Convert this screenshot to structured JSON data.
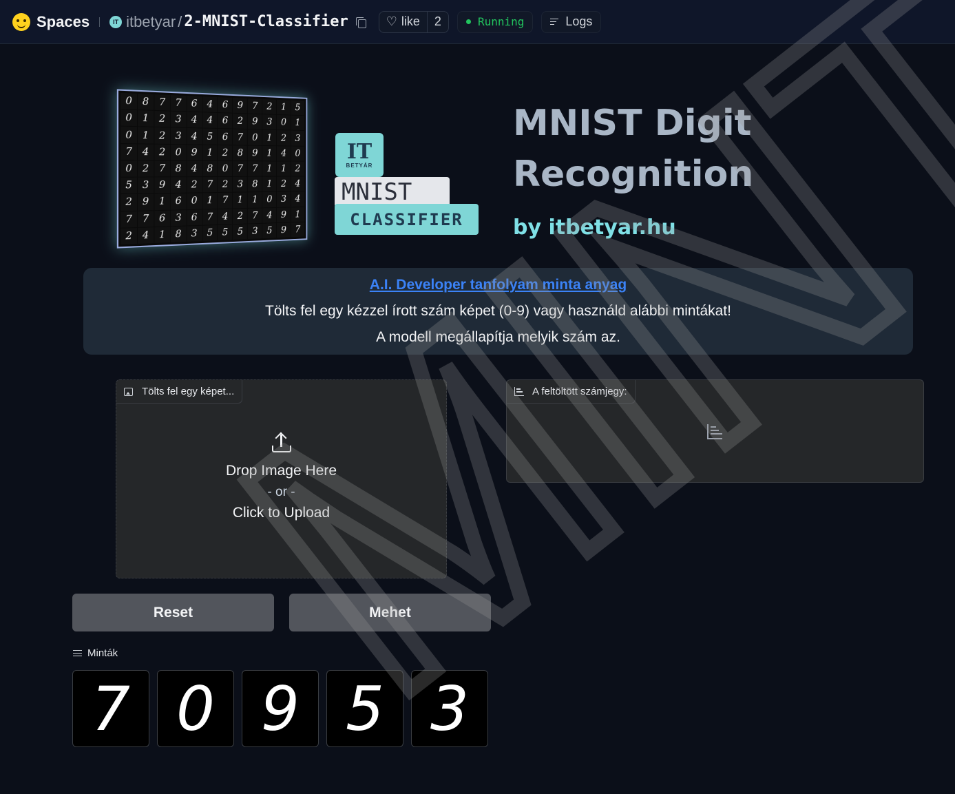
{
  "topbar": {
    "brand": "Spaces",
    "owner": "itbetyar",
    "separator": "/",
    "repo": "2-MNIST-Classifier",
    "like_label": "like",
    "like_count": "2",
    "status": "Running",
    "logs_label": "Logs",
    "status_color": "#22c55e"
  },
  "hero": {
    "logo_it": "IT",
    "logo_betyar": "BETYÁR",
    "logo_mnist": "MNIST",
    "logo_classifier": "CLASSIFIER",
    "title": "MNIST Digit Recognition",
    "byline": "by itbetyar.hu",
    "digit_grid": [
      [
        "0",
        "8",
        "7",
        "7",
        "6",
        "4",
        "6",
        "9",
        "7",
        "2",
        "1",
        "5"
      ],
      [
        "0",
        "1",
        "2",
        "3",
        "4",
        "4",
        "6",
        "2",
        "9",
        "3",
        "0",
        "1"
      ],
      [
        "0",
        "1",
        "2",
        "3",
        "4",
        "5",
        "6",
        "7",
        "0",
        "1",
        "2",
        "3"
      ],
      [
        "7",
        "4",
        "2",
        "0",
        "9",
        "1",
        "2",
        "8",
        "9",
        "1",
        "4",
        "0"
      ],
      [
        "0",
        "2",
        "7",
        "8",
        "4",
        "8",
        "0",
        "7",
        "7",
        "1",
        "1",
        "2"
      ],
      [
        "5",
        "3",
        "9",
        "4",
        "2",
        "7",
        "2",
        "3",
        "8",
        "1",
        "2",
        "4"
      ],
      [
        "2",
        "9",
        "1",
        "6",
        "0",
        "1",
        "7",
        "1",
        "1",
        "0",
        "3",
        "4"
      ],
      [
        "7",
        "7",
        "6",
        "3",
        "6",
        "7",
        "4",
        "2",
        "7",
        "4",
        "9",
        "1"
      ],
      [
        "2",
        "4",
        "1",
        "8",
        "3",
        "5",
        "5",
        "5",
        "3",
        "5",
        "9",
        "7"
      ]
    ]
  },
  "description": {
    "link": "A.I. Developer tanfolyam minta anyag",
    "line1": "Tölts fel egy kézzel írott szám képet (0-9) vagy használd alábbi mintákat!",
    "line2": "A modell megállapítja melyik szám az."
  },
  "upload": {
    "label": "Tölts fel egy képet...",
    "drop": "Drop Image Here",
    "or": "- or -",
    "click": "Click to Upload"
  },
  "output": {
    "label": "A feltöltött számjegy:"
  },
  "buttons": {
    "reset": "Reset",
    "submit": "Mehet"
  },
  "examples": {
    "label": "Minták",
    "items": [
      "7",
      "0",
      "9",
      "5",
      "3"
    ]
  },
  "watermark": "MINTA"
}
